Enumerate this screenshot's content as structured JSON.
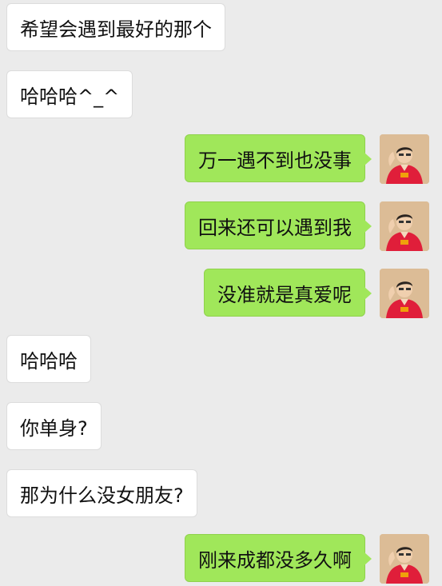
{
  "messages": [
    {
      "side": "left",
      "text": "希望会遇到最好的那个"
    },
    {
      "side": "left",
      "text": "哈哈哈^_^"
    },
    {
      "side": "right",
      "text": "万一遇不到也没事",
      "avatar_icon": "user-avatar-icon"
    },
    {
      "side": "right",
      "text": "回来还可以遇到我",
      "avatar_icon": "user-avatar-icon"
    },
    {
      "side": "right",
      "text": "没准就是真爱呢",
      "avatar_icon": "user-avatar-icon"
    },
    {
      "side": "left",
      "text": "哈哈哈"
    },
    {
      "side": "left",
      "text": "你单身?"
    },
    {
      "side": "left",
      "text": "那为什么没女朋友?"
    },
    {
      "side": "right",
      "text": "刚来成都没多久啊",
      "avatar_icon": "user-avatar-icon"
    }
  ],
  "colors": {
    "background": "#ebebeb",
    "incoming_bubble": "#ffffff",
    "outgoing_bubble": "#a0e75a"
  }
}
